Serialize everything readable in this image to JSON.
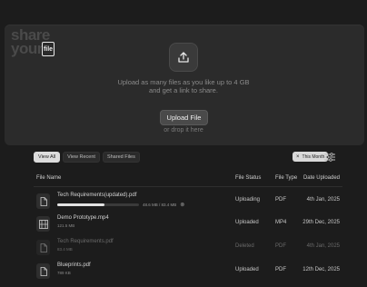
{
  "brand": {
    "line1": "share",
    "line2": "your",
    "badge": "file"
  },
  "upload": {
    "icon": "upload-icon",
    "line1": "Upload as many files as you like up to 4 GB",
    "line2": "and get a link to share.",
    "button": "Upload File",
    "drop": "or drop it here"
  },
  "tabs": [
    "View All",
    "View Recent",
    "Shared Files"
  ],
  "active_tab": "View All",
  "filter": {
    "label": "This Month",
    "icon": "close-icon"
  },
  "settings_icon": "sliders-icon",
  "columns": {
    "name": "File Name",
    "status": "File Status",
    "type": "File Type",
    "date": "Date Uploaded"
  },
  "files": [
    {
      "name": "Tech Requirements(updated).pdf",
      "size": "",
      "progress_text": "48.6 MB / 83.4 MB",
      "progress": 0.58,
      "status": "Uploading",
      "type": "PDF",
      "date": "4th Jan, 2025",
      "icon": "document-icon"
    },
    {
      "name": "Demo Prototype.mp4",
      "size": "121.5 MB",
      "status": "Uploaded",
      "type": "MP4",
      "date": "29th Dec, 2025",
      "icon": "video-icon"
    },
    {
      "name": "Tech Requirements.pdf",
      "size": "83.4 MB",
      "status": "Deleted",
      "type": "PDF",
      "date": "4th Jan, 2025",
      "icon": "document-icon"
    },
    {
      "name": "Blueprints.pdf",
      "size": "789 KB",
      "status": "Uploaded",
      "type": "PDF",
      "date": "12th Dec, 2025",
      "icon": "document-icon"
    }
  ]
}
